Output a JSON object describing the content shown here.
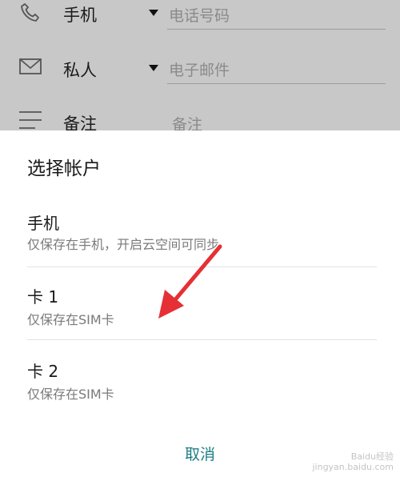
{
  "form": {
    "rows": [
      {
        "label": "手机",
        "field": "电话号码"
      },
      {
        "label": "私人",
        "field": "电子邮件"
      },
      {
        "label": "备注",
        "field": "备注"
      }
    ]
  },
  "dialog": {
    "title": "选择帐户",
    "options": [
      {
        "name": "手机",
        "desc": "仅保存在手机，开启云空间可同步"
      },
      {
        "name": "卡 1",
        "desc": "仅保存在SIM卡"
      },
      {
        "name": "卡 2",
        "desc": "仅保存在SIM卡"
      }
    ],
    "cancel": "取消"
  },
  "watermark": {
    "line1": "Baidu经验",
    "line2": "jingyan.baidu.com"
  },
  "colors": {
    "accent": "#1e7e83",
    "arrow": "#e53035"
  }
}
